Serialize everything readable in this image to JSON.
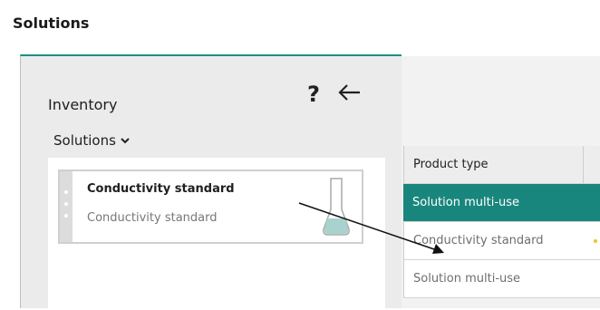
{
  "page": {
    "title": "Solutions"
  },
  "panel": {
    "title": "Inventory",
    "help_label": "?",
    "filter_label": "Solutions",
    "item": {
      "title": "Conductivity standard",
      "subtitle": "Conductivity standard",
      "icon": "flask-icon"
    }
  },
  "table": {
    "header": "Product type",
    "rows": [
      {
        "label": "Solution multi-use",
        "selected": true
      },
      {
        "label": "Conductivity standard",
        "selected": false
      },
      {
        "label": "Solution multi-use",
        "selected": false
      }
    ]
  },
  "colors": {
    "accent": "#19867d",
    "panel_bg": "#ebebeb"
  }
}
